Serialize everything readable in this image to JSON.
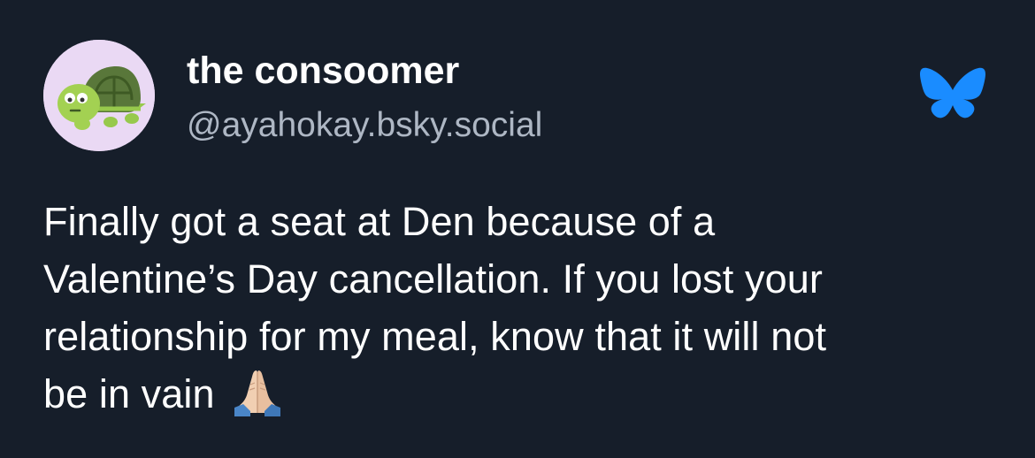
{
  "post": {
    "author": {
      "display_name": "the consoomer",
      "handle": "@ayahokay.bsky.social",
      "avatar_icon": "turtle-icon",
      "avatar_bg": "#ead9f4"
    },
    "platform_icon": "bluesky-butterfly-icon",
    "platform_color": "#1a8cff",
    "text_lines": [
      "Finally got a seat at Den because of a",
      "Valentine’s Day cancellation. If you lost your",
      "relationship for my meal, know that it will not",
      "be in vain"
    ],
    "trailing_emoji": "folded-hands-emoji"
  },
  "theme": {
    "background": "#161e2a",
    "text": "#ffffff",
    "muted_text": "#aeb7c4"
  }
}
